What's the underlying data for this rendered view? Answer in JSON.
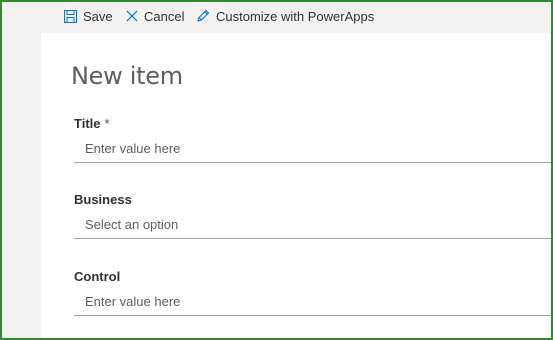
{
  "toolbar": {
    "save_label": "Save",
    "cancel_label": "Cancel",
    "customize_label": "Customize with PowerApps"
  },
  "form": {
    "title": "New item",
    "fields": [
      {
        "label": "Title",
        "required_mark": "*",
        "placeholder": "Enter value here"
      },
      {
        "label": "Business",
        "placeholder": "Select an option"
      },
      {
        "label": "Control",
        "placeholder": "Enter value here"
      }
    ]
  },
  "colors": {
    "frame_border": "#2e8b2e",
    "toolbar_bg": "#f3f2f1",
    "required": "#a4262c",
    "icon": "#0078d4"
  }
}
